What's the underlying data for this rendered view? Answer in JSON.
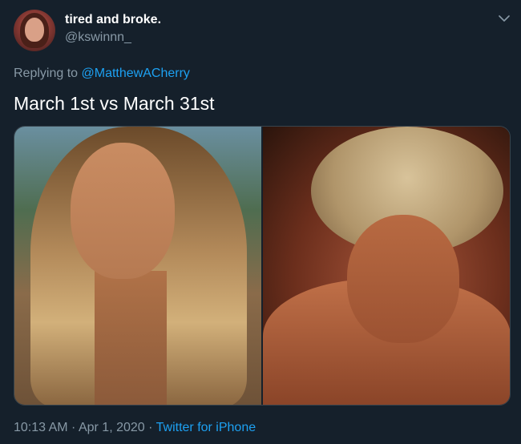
{
  "user": {
    "display_name": "tired and broke.",
    "handle": "@kswinnn_"
  },
  "reply": {
    "prefix": "Replying to",
    "mention": "@MatthewACherry"
  },
  "tweet": {
    "text": "March 1st vs March 31st"
  },
  "meta": {
    "time": "10:13 AM",
    "separator1": " · ",
    "date": "Apr 1, 2020",
    "separator2": " · ",
    "source": "Twitter for iPhone"
  },
  "icons": {
    "caret": "chevron-down-icon"
  },
  "colors": {
    "background": "#15202b",
    "secondary_text": "#8899a6",
    "link": "#1da1f2"
  }
}
